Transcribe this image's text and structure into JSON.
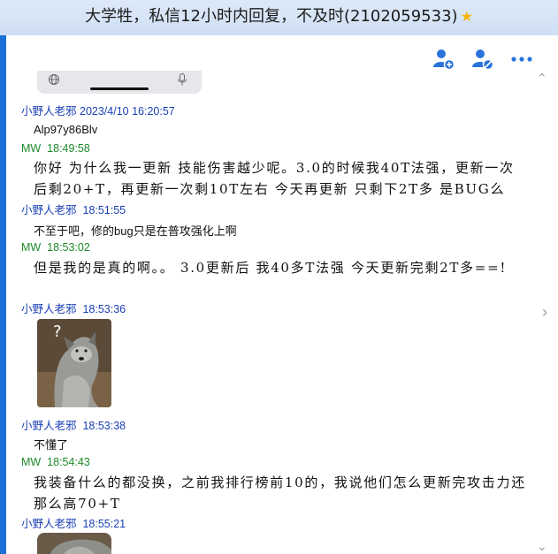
{
  "window": {
    "title": "大学牲，私信12小时内回复，不及时(2102059533)",
    "title_icon": "star-icon"
  },
  "toolbar": {
    "icons": [
      "add-friend-icon",
      "block-user-icon",
      "more-icon"
    ]
  },
  "messages": [
    {
      "sender": "小野人老邪",
      "time": "2023/4/10 16:20:57",
      "side": "them",
      "text": "Alp97y86Blv"
    },
    {
      "sender": "MW",
      "time": "18:49:58",
      "side": "me",
      "text": "你好 为什么我一更新 技能伤害越少呢。3.0的时候我40T法强，更新一次后剩20+T，再更新一次剩10T左右 今天再更新 只剩下2T多  是BUG么"
    },
    {
      "sender": "小野人老邪",
      "time": "18:51:55",
      "side": "them",
      "text": "不至于吧，修的bug只是在普攻强化上啊"
    },
    {
      "sender": "MW",
      "time": "18:53:02",
      "side": "me",
      "text": "但是我的是真的啊。。  3.0更新后 我40多T法强 今天更新完剩2T多==!"
    },
    {
      "sender": "小野人老邪",
      "time": "18:53:36",
      "side": "them",
      "image": "confused-wolf-photo"
    },
    {
      "sender": "小野人老邪",
      "time": "18:53:38",
      "side": "them",
      "text": "不懂了"
    },
    {
      "sender": "MW",
      "time": "18:54:43",
      "side": "me",
      "text": "我装备什么的都没换，之前我排行榜前10的，我说他们怎么更新完攻击力还那么高70+T"
    },
    {
      "sender": "小野人老邪",
      "time": "18:55:21",
      "side": "them",
      "image": "wolf-photo-partial"
    }
  ],
  "colors": {
    "titlebar": "#d5e4f6",
    "accent_strip": "#1c6fd6",
    "them_name": "#1a3fb5",
    "me_name": "#1e8a2a",
    "toolbar_icon": "#2a73d9"
  }
}
